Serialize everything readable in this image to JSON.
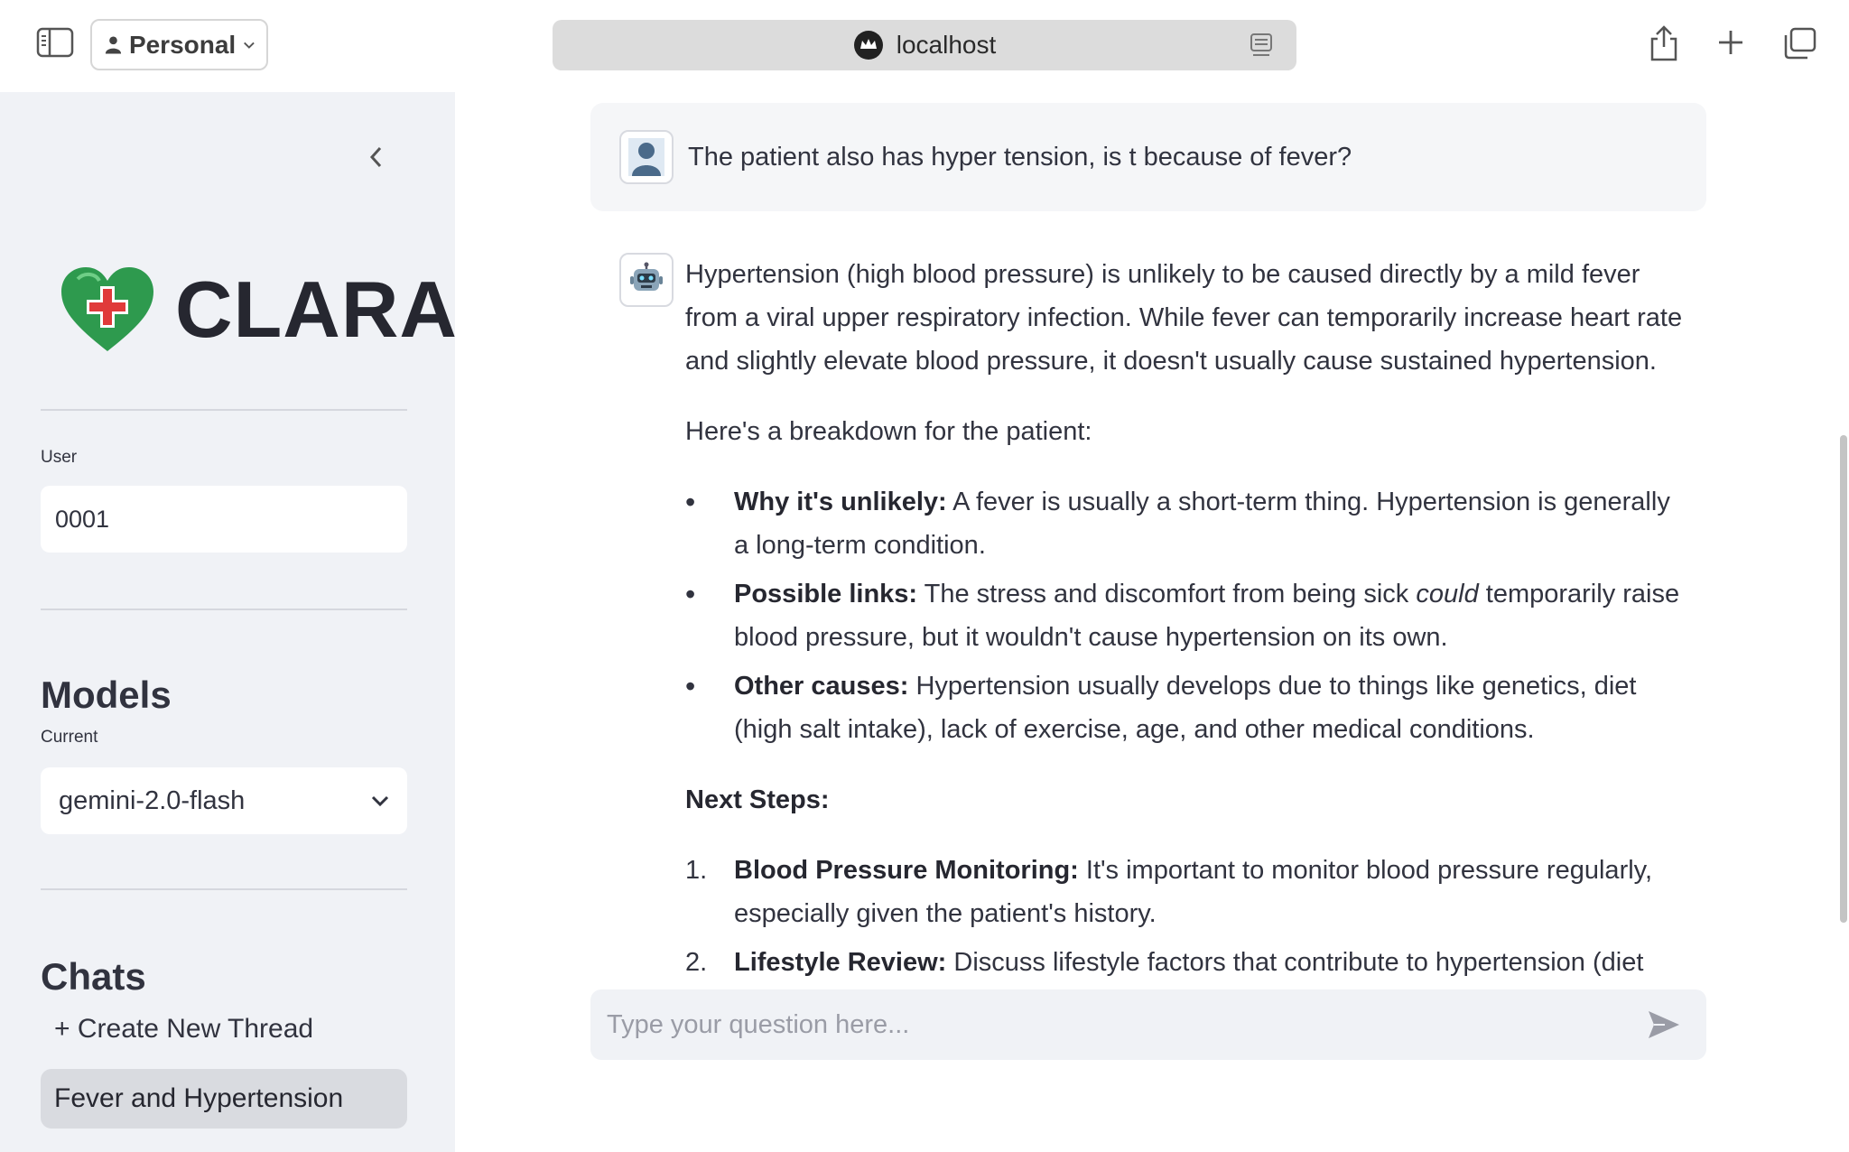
{
  "browser": {
    "profile_label": "Personal",
    "address": "localhost"
  },
  "sidebar": {
    "logo_text": "CLARA",
    "user_label": "User",
    "user_value": "0001",
    "models_title": "Models",
    "current_label": "Current",
    "current_model": "gemini-2.0-flash",
    "chats_title": "Chats",
    "new_thread_label": "+ Create New Thread",
    "threads": [
      "Fever and Hypertension"
    ]
  },
  "chat": {
    "user_message": "The patient also has hyper tension, is t because of fever?",
    "bot": {
      "p1": "Hypertension (high blood pressure) is unlikely to be caused directly by a mild fever from a viral upper respiratory infection. While fever can temporarily increase heart rate and slightly elevate blood pressure, it doesn't usually cause sustained hypertension.",
      "p2": "Here's a breakdown for the patient:",
      "bullets": [
        {
          "bold": "Why it's unlikely:",
          "text": " A fever is usually a short-term thing. Hypertension is generally a long-term condition."
        },
        {
          "bold": "Possible links:",
          "text_before": " The stress and discomfort from being sick ",
          "italic": "could",
          "text_after": " temporarily raise blood pressure, but it wouldn't cause hypertension on its own."
        },
        {
          "bold": "Other causes:",
          "text": " Hypertension usually develops due to things like genetics, diet (high salt intake), lack of exercise, age, and other medical conditions."
        }
      ],
      "next_steps_title": "Next Steps:",
      "steps": [
        {
          "num": "1.",
          "bold": "Blood Pressure Monitoring:",
          "text": " It's important to monitor blood pressure regularly, especially given the patient's history."
        },
        {
          "num": "2.",
          "bold": "Lifestyle Review:",
          "text": " Discuss lifestyle factors that contribute to hypertension (diet"
        }
      ]
    },
    "input_placeholder": "Type your question here..."
  }
}
